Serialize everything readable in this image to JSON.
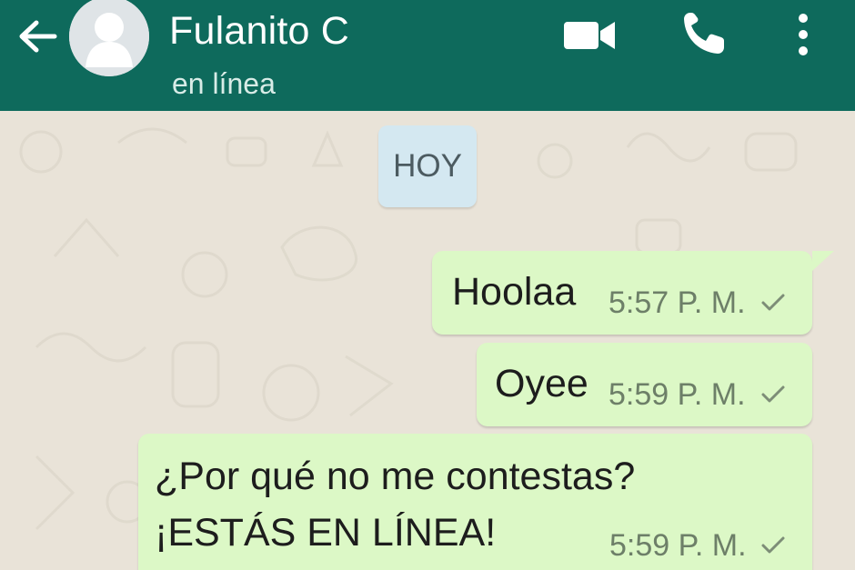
{
  "header": {
    "contact_name": "Fulanito C",
    "status": "en línea"
  },
  "chat": {
    "date_label": "HOY",
    "messages": [
      {
        "lines": [
          "Hoolaa"
        ],
        "time": "5:57 P. M.",
        "status_icon": "single-check-icon"
      },
      {
        "lines": [
          "Oyee"
        ],
        "time": "5:59 P. M.",
        "status_icon": "single-check-icon"
      },
      {
        "lines": [
          "¿Por qué no me contestas?",
          "¡ESTÁS EN LÍNEA!"
        ],
        "time": "5:59 P. M.",
        "status_icon": "single-check-icon"
      }
    ]
  },
  "colors": {
    "header": "#0e6a5c",
    "chat_background": "#e9e3d8",
    "outgoing_bubble": "#dcf8c6",
    "date_chip": "#d4e8f1"
  }
}
